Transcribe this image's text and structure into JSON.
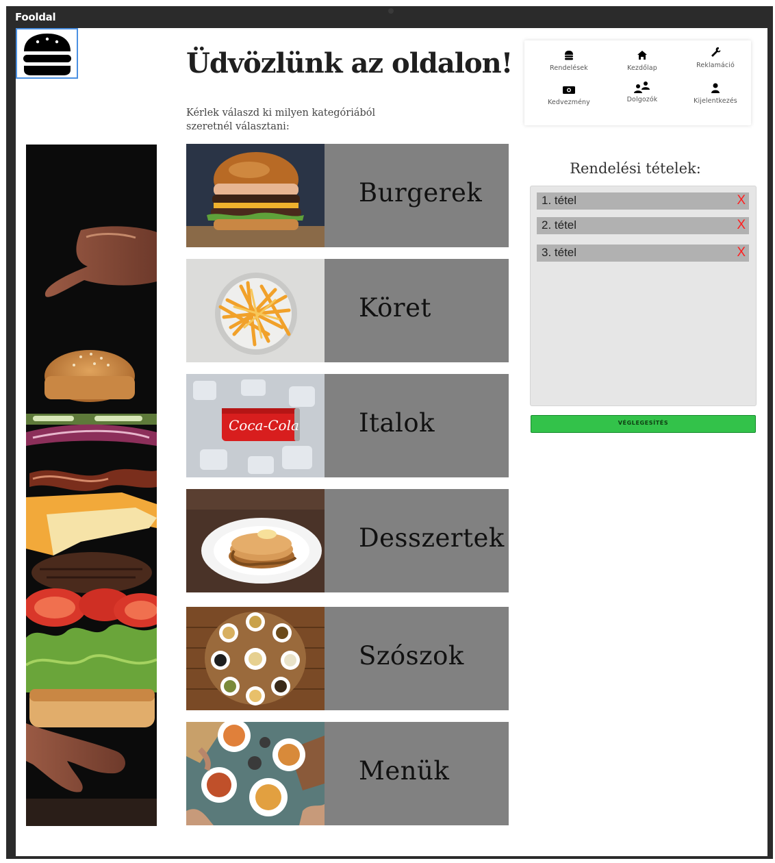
{
  "window": {
    "title": "Fooldal"
  },
  "header": {
    "title": "Üdvözlünk az oldalon!",
    "subtitle": "Kérlek válaszd ki milyen kategóriából szeretnél választani:"
  },
  "categories": [
    {
      "label": "Burgerek",
      "image": "burger-photo"
    },
    {
      "label": "Köret",
      "image": "fries-photo"
    },
    {
      "label": "Italok",
      "image": "coca-cola-can-photo"
    },
    {
      "label": "Desszertek",
      "image": "pancakes-photo"
    },
    {
      "label": "Szószok",
      "image": "sauces-photo"
    },
    {
      "label": "Menük",
      "image": "meals-table-photo"
    }
  ],
  "nav": {
    "items": [
      {
        "label": "Rendelések",
        "icon": "burger-icon"
      },
      {
        "label": "Kezdőlap",
        "icon": "home-icon"
      },
      {
        "label": "Reklamáció",
        "icon": "wrench-icon"
      },
      {
        "label": "Kedvezmény",
        "icon": "money-icon"
      },
      {
        "label": "Dolgozók",
        "icon": "users-icon"
      },
      {
        "label": "Kijelentkezés",
        "icon": "user-icon"
      }
    ]
  },
  "order": {
    "title": "Rendelési tételek:",
    "items": [
      {
        "label": "1. tétel",
        "remove": "X"
      },
      {
        "label": "2. tétel",
        "remove": "X"
      },
      {
        "label": "3. tétel",
        "remove": "X"
      }
    ],
    "finalize_label": "VÉGLEGESÍTÉS"
  },
  "colors": {
    "category_bg": "#818181",
    "order_box_bg": "#e6e6e6",
    "order_item_bg": "#b1b1b1",
    "remove_red": "#ff1f1f",
    "finalize_green": "#33c24a",
    "frame_dark": "#2b2b2b"
  }
}
